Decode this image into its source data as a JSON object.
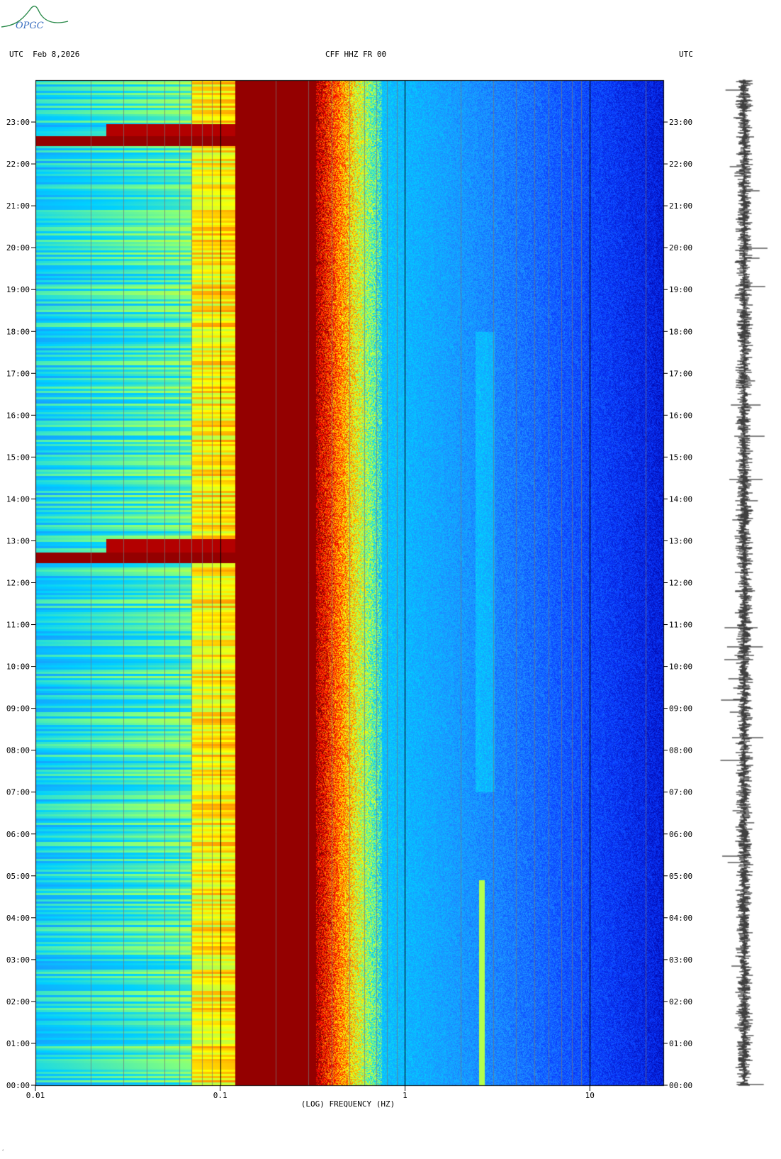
{
  "logo": {
    "text": "OPGC",
    "color": "#2a8a4a",
    "accent": "#3a6fc0"
  },
  "header": {
    "left": "UTC  Feb 8,2026",
    "center": "CFF HHZ FR 00",
    "right": "UTC"
  },
  "footer_mark": "ʿ",
  "chart_data": {
    "type": "heatmap",
    "title": "CFF HHZ FR 00",
    "xlabel": "(LOG) FREQUENCY (HZ)",
    "ylabel": "",
    "x_scale": "log",
    "xlim": [
      0.01,
      25
    ],
    "x_ticks": [
      {
        "value": 0.01,
        "label": "0.01"
      },
      {
        "value": 0.1,
        "label": "0.1"
      },
      {
        "value": 1,
        "label": "1"
      },
      {
        "value": 10,
        "label": "10"
      }
    ],
    "ylim_hours": [
      0,
      24
    ],
    "y_tick_labels": [
      "00:00",
      "01:00",
      "02:00",
      "03:00",
      "04:00",
      "05:00",
      "06:00",
      "07:00",
      "08:00",
      "09:00",
      "10:00",
      "11:00",
      "12:00",
      "13:00",
      "14:00",
      "15:00",
      "16:00",
      "17:00",
      "18:00",
      "19:00",
      "20:00",
      "21:00",
      "22:00",
      "23:00"
    ],
    "colormap": [
      "#0000a0",
      "#0a3aff",
      "#1e90ff",
      "#00d0ff",
      "#80ff80",
      "#ffff00",
      "#ff8000",
      "#ff0000",
      "#800000"
    ],
    "features": [
      {
        "name": "microseism peak",
        "freq_range": [
          0.12,
          0.4
        ],
        "level": "max"
      },
      {
        "name": "long-period transient",
        "hour": 12.5,
        "freq_range": [
          0.01,
          0.12
        ]
      },
      {
        "name": "long-period transient",
        "hour": 22.5,
        "freq_range": [
          0.01,
          0.12
        ]
      },
      {
        "name": "narrow line",
        "freq": 2.6,
        "hour_range": [
          0,
          4.9
        ]
      }
    ],
    "seismogram_trace": true
  }
}
